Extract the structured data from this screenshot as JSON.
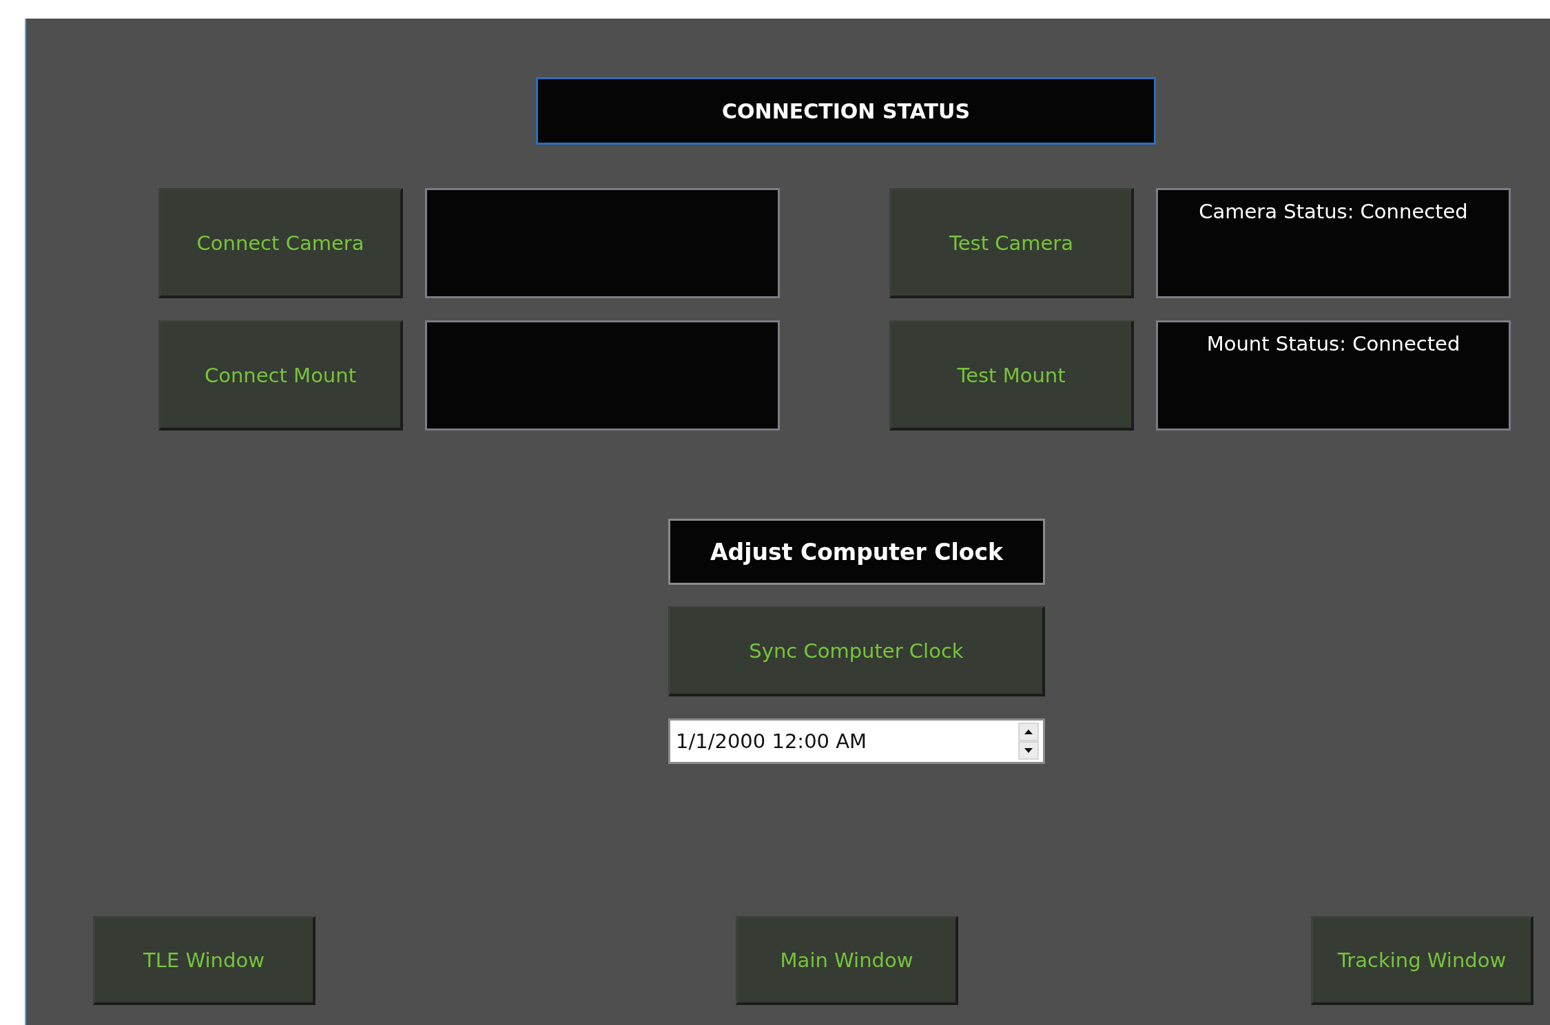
{
  "title": "CONNECTION STATUS",
  "devices": [
    {
      "connect_button": "Connect Camera",
      "test_button": "Test Camera",
      "status": "Camera Status: Connected"
    },
    {
      "connect_button": "Connect Mount",
      "test_button": "Test Mount",
      "status": "Mount Status: Connected"
    }
  ],
  "clock": {
    "heading": "Adjust Computer Clock",
    "sync_button": "Sync Computer Clock",
    "date_value": "1/1/2000 12:00 AM"
  },
  "nav_buttons": [
    "TLE Window",
    "Main Window",
    "Tracking Window"
  ]
}
